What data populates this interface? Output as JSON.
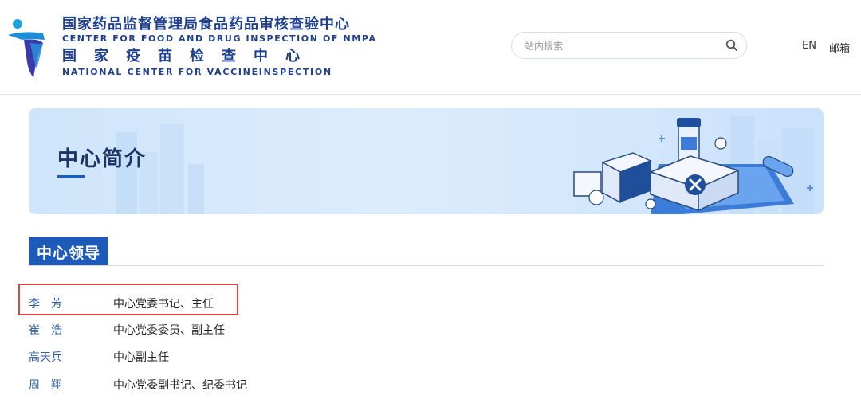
{
  "header": {
    "org_cn": "国家药品监督管理局食品药品审核查验中心",
    "org_en": "CENTER FOR FOOD AND DRUG INSPECTION OF NMPA",
    "center_cn": "国家疫苗检查中心",
    "center_en": "NATIONAL CENTER FOR VACCINEINSPECTION",
    "search_placeholder": "站内搜索",
    "lang_label": "EN",
    "mail_label": "邮箱"
  },
  "banner": {
    "title": "中心简介"
  },
  "section": {
    "title": "中心领导"
  },
  "leaders": [
    {
      "name": "李　芳",
      "title": "中心党委书记、主任"
    },
    {
      "name": "崔　浩",
      "title": "中心党委委员、副主任"
    },
    {
      "name": "高天兵",
      "title": "中心副主任"
    },
    {
      "name": "周　翔",
      "title": "中心党委副书记、纪委书记"
    }
  ],
  "colors": {
    "brand": "#1e3f8f",
    "accent": "#1e5ab8",
    "link": "#2d5fa6",
    "highlight_border": "#e0463f",
    "banner_bg": "#d4e8fc"
  },
  "icons": {
    "logo": "cfdi-logo-icon",
    "search": "search-icon"
  }
}
